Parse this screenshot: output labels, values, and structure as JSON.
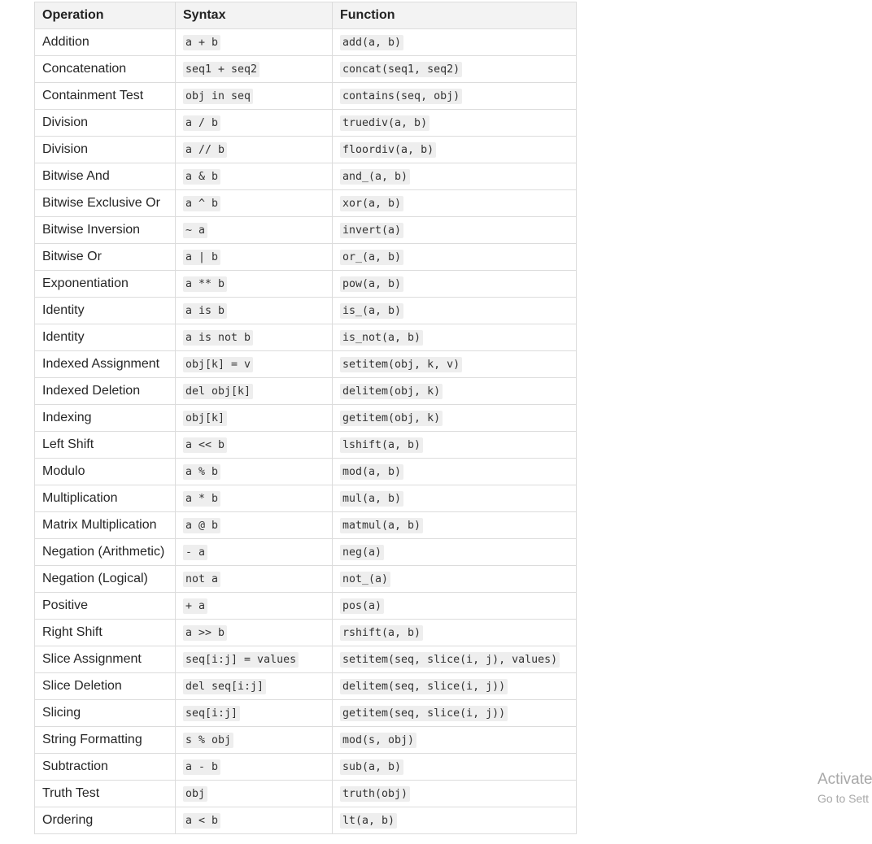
{
  "headers": {
    "operation": "Operation",
    "syntax": "Syntax",
    "function": "Function"
  },
  "rows": [
    {
      "operation": "Addition",
      "syntax": "a + b",
      "function": "add(a, b)"
    },
    {
      "operation": "Concatenation",
      "syntax": "seq1 + seq2",
      "function": "concat(seq1, seq2)"
    },
    {
      "operation": "Containment Test",
      "syntax": "obj in seq",
      "function": "contains(seq, obj)"
    },
    {
      "operation": "Division",
      "syntax": "a / b",
      "function": "truediv(a, b)"
    },
    {
      "operation": "Division",
      "syntax": "a // b",
      "function": "floordiv(a, b)"
    },
    {
      "operation": "Bitwise And",
      "syntax": "a & b",
      "function": "and_(a, b)"
    },
    {
      "operation": "Bitwise Exclusive Or",
      "syntax": "a ^ b",
      "function": "xor(a, b)"
    },
    {
      "operation": "Bitwise Inversion",
      "syntax": "~ a",
      "function": "invert(a)"
    },
    {
      "operation": "Bitwise Or",
      "syntax": "a | b",
      "function": "or_(a, b)"
    },
    {
      "operation": "Exponentiation",
      "syntax": "a ** b",
      "function": "pow(a, b)"
    },
    {
      "operation": "Identity",
      "syntax": "a is b",
      "function": "is_(a, b)"
    },
    {
      "operation": "Identity",
      "syntax": "a is not b",
      "function": "is_not(a, b)"
    },
    {
      "operation": "Indexed Assignment",
      "syntax": "obj[k] = v",
      "function": "setitem(obj, k, v)"
    },
    {
      "operation": "Indexed Deletion",
      "syntax": "del obj[k]",
      "function": "delitem(obj, k)"
    },
    {
      "operation": "Indexing",
      "syntax": "obj[k]",
      "function": "getitem(obj, k)"
    },
    {
      "operation": "Left Shift",
      "syntax": "a << b",
      "function": "lshift(a, b)"
    },
    {
      "operation": "Modulo",
      "syntax": "a % b",
      "function": "mod(a, b)"
    },
    {
      "operation": "Multiplication",
      "syntax": "a * b",
      "function": "mul(a, b)"
    },
    {
      "operation": "Matrix Multiplication",
      "syntax": "a @ b",
      "function": "matmul(a, b)"
    },
    {
      "operation": "Negation (Arithmetic)",
      "syntax": "- a",
      "function": "neg(a)"
    },
    {
      "operation": "Negation (Logical)",
      "syntax": "not a",
      "function": "not_(a)"
    },
    {
      "operation": "Positive",
      "syntax": "+ a",
      "function": "pos(a)"
    },
    {
      "operation": "Right Shift",
      "syntax": "a >> b",
      "function": "rshift(a, b)"
    },
    {
      "operation": "Slice Assignment",
      "syntax": "seq[i:j] = values",
      "function": "setitem(seq, slice(i, j), values)"
    },
    {
      "operation": "Slice Deletion",
      "syntax": "del seq[i:j]",
      "function": "delitem(seq, slice(i, j))"
    },
    {
      "operation": "Slicing",
      "syntax": "seq[i:j]",
      "function": "getitem(seq, slice(i, j))"
    },
    {
      "operation": "String Formatting",
      "syntax": "s % obj",
      "function": "mod(s, obj)"
    },
    {
      "operation": "Subtraction",
      "syntax": "a - b",
      "function": "sub(a, b)"
    },
    {
      "operation": "Truth Test",
      "syntax": "obj",
      "function": "truth(obj)"
    },
    {
      "operation": "Ordering",
      "syntax": "a < b",
      "function": "lt(a, b)"
    }
  ],
  "watermark": {
    "title": "Activate",
    "subtitle": "Go to Sett"
  }
}
